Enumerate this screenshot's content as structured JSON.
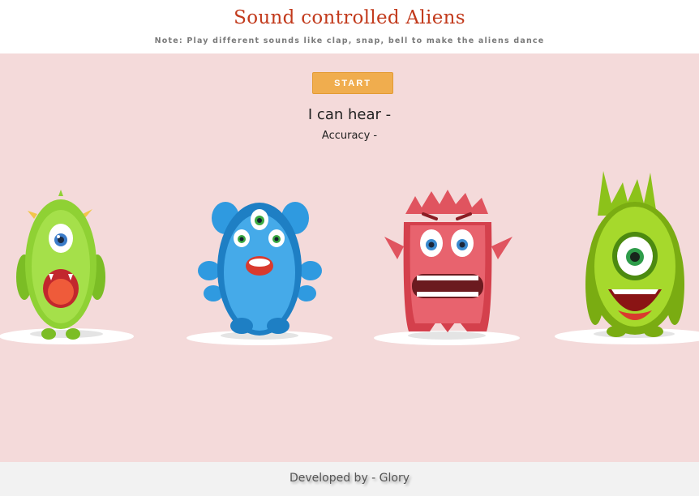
{
  "header": {
    "title": "Sound controlled Aliens",
    "note": "Note: Play different sounds like clap, snap, bell to make the aliens dance"
  },
  "controls": {
    "start_label": "START"
  },
  "status": {
    "hear_label": "I can hear -",
    "accuracy_label": "Accuracy -"
  },
  "aliens": [
    {
      "name": "green-one-eyed-alien",
      "color": "#8fd134"
    },
    {
      "name": "blue-three-eyed-alien",
      "color": "#2f9ae0"
    },
    {
      "name": "red-furry-alien",
      "color": "#e0545f"
    },
    {
      "name": "lime-cyclops-alien",
      "color": "#8cc21a"
    }
  ],
  "footer": {
    "credit": "Developed by - Glory"
  },
  "colors": {
    "title": "#c23a1c",
    "stage_background": "#f4dada",
    "button": "#f0ad4e",
    "footer_background": "#f2f2f2"
  }
}
